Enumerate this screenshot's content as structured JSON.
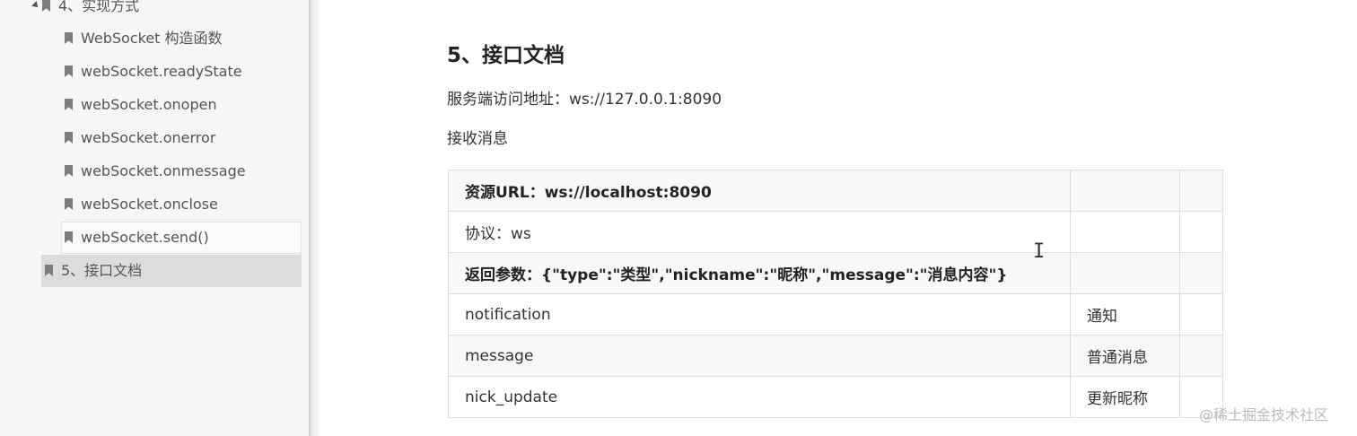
{
  "sidebar": {
    "items": [
      {
        "label": "4、实现方式"
      },
      {
        "label": "WebSocket 构造函数"
      },
      {
        "label": "webSocket.readyState"
      },
      {
        "label": "webSocket.onopen"
      },
      {
        "label": "webSocket.onerror"
      },
      {
        "label": "webSocket.onmessage"
      },
      {
        "label": "webSocket.onclose"
      },
      {
        "label": "webSocket.send()"
      },
      {
        "label": "5、接口文档"
      }
    ]
  },
  "main": {
    "title": "5、接口文档",
    "server_address": "服务端访问地址：ws://127.0.0.1:8090",
    "receive_label": "接收消息",
    "table": {
      "rows": [
        [
          "资源URL：ws://localhost:8090",
          "",
          ""
        ],
        [
          "协议：ws",
          "",
          ""
        ],
        [
          "返回参数：{\"type\":\"类型\",\"nickname\":\"昵称\",\"message\":\"消息内容\"}",
          "",
          ""
        ],
        [
          "notification",
          "通知",
          ""
        ],
        [
          "message",
          "普通消息",
          ""
        ],
        [
          "nick_update",
          "更新昵称",
          ""
        ]
      ]
    }
  },
  "watermark": "@稀土掘金技术社区",
  "colors": {
    "sidebar_bg": "#f6f6f6",
    "active_item_bg": "#dcdcdc",
    "table_border": "#dddddd"
  }
}
